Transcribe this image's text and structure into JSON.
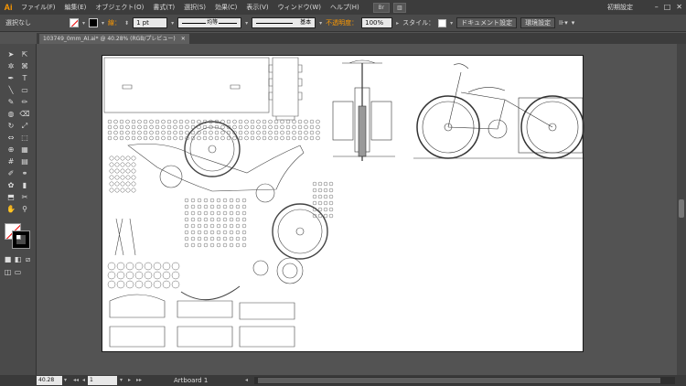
{
  "app": {
    "logo": "Ai"
  },
  "menu": [
    "ファイル(F)",
    "編集(E)",
    "オブジェクト(O)",
    "書式(T)",
    "選択(S)",
    "効果(C)",
    "表示(V)",
    "ウィンドウ(W)",
    "ヘルプ(H)"
  ],
  "workspace": "初期設定",
  "control": {
    "selection": "選択なし",
    "stroke_label": "線：",
    "stroke_weight": "1 pt",
    "profile": "均等",
    "brush": "基本",
    "opacity_label": "不透明度：",
    "opacity_value": "100%",
    "style_label": "スタイル：",
    "document_setup": "ドキュメント設定",
    "preferences": "環境設定"
  },
  "document": {
    "tab_title": "103749_0mm_AI.ai* @ 40.28% (RGB/プレビュー)"
  },
  "status": {
    "zoom": "40.28",
    "page": "1",
    "artboard_name": "Artboard 1"
  },
  "colors": {
    "accent": "#ff9a00",
    "ui_dark": "#3c3c3c",
    "ui_mid": "#4a4a4a",
    "pasteboard": "#535353",
    "artboard": "#ffffff"
  },
  "icons": {
    "tools": [
      "selection-tool-icon",
      "direct-selection-tool-icon",
      "magic-wand-tool-icon",
      "lasso-tool-icon",
      "pen-tool-icon",
      "type-tool-icon",
      "line-tool-icon",
      "rectangle-tool-icon",
      "paintbrush-tool-icon",
      "pencil-tool-icon",
      "blob-brush-tool-icon",
      "eraser-tool-icon",
      "rotate-tool-icon",
      "scale-tool-icon",
      "width-tool-icon",
      "free-transform-tool-icon",
      "shape-builder-tool-icon",
      "perspective-grid-tool-icon",
      "mesh-tool-icon",
      "gradient-tool-icon",
      "eyedropper-tool-icon",
      "blend-tool-icon",
      "symbol-sprayer-tool-icon",
      "column-graph-tool-icon",
      "artboard-tool-icon",
      "slice-tool-icon",
      "hand-tool-icon",
      "zoom-tool-icon"
    ]
  }
}
